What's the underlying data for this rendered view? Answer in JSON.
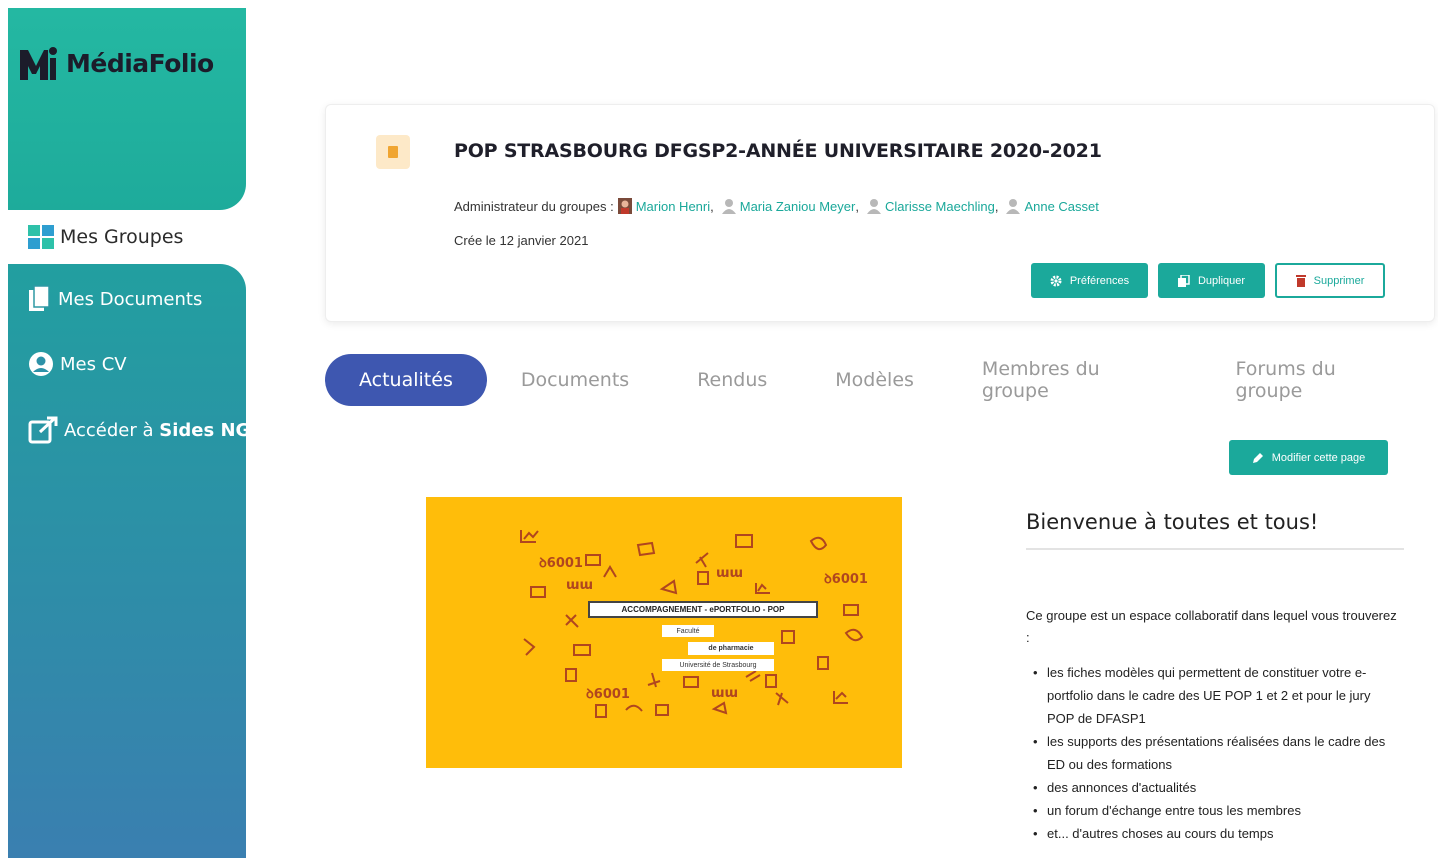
{
  "brand": {
    "name": "MédiaFolio"
  },
  "sidebar": {
    "items": [
      {
        "label": "Mes Groupes",
        "icon": "grid-icon",
        "active": true
      },
      {
        "label": "Mes Documents",
        "icon": "documents-icon"
      },
      {
        "label": "Mes CV",
        "icon": "user-circle-icon"
      },
      {
        "label_prefix": "Accéder à ",
        "label_bold": "Sides NG",
        "icon": "external-link-icon"
      }
    ]
  },
  "group": {
    "title": "POP STRASBOURG DFGSP2-ANNÉE UNIVERSITAIRE 2020-2021",
    "admins_label": "Administrateur du groupes :",
    "admins": [
      "Marion Henri",
      "Maria Zaniou Meyer",
      "Clarisse Maechling",
      "Anne Casset"
    ],
    "created": "Crée le 12 janvier 2021",
    "buttons": {
      "preferences": "Préférences",
      "duplicate": "Dupliquer",
      "delete": "Supprimer"
    }
  },
  "tabs": [
    "Actualités",
    "Documents",
    "Rendus",
    "Modèles",
    "Membres du groupe",
    "Forums du groupe"
  ],
  "edit_button": "Modifier cette page",
  "banner": {
    "title": "ACCOMPAGNEMENT - ePORTFOLIO - POP",
    "line1": "Faculté",
    "line2": "de pharmacie",
    "line3": "Université de Strasbourg"
  },
  "content": {
    "welcome": "Bienvenue à toutes et tous!",
    "intro": "Ce groupe est un espace collaboratif dans lequel vous trouverez :",
    "bullets": [
      "les fiches modèles qui permettent de constituer votre e-portfolio dans le cadre des UE POP 1 et 2 et pour le jury POP de DFASP1",
      "les supports des présentations réalisées dans le cadre des ED ou des formations",
      "des annonces d'actualités",
      "un forum d'échange entre tous les membres",
      "et... d'autres choses au cours du temps"
    ]
  },
  "colors": {
    "teal": "#1ba99b",
    "tab_active": "#3e57b0",
    "banner": "#ffbd0a",
    "icon_orange": "#f0a531"
  }
}
